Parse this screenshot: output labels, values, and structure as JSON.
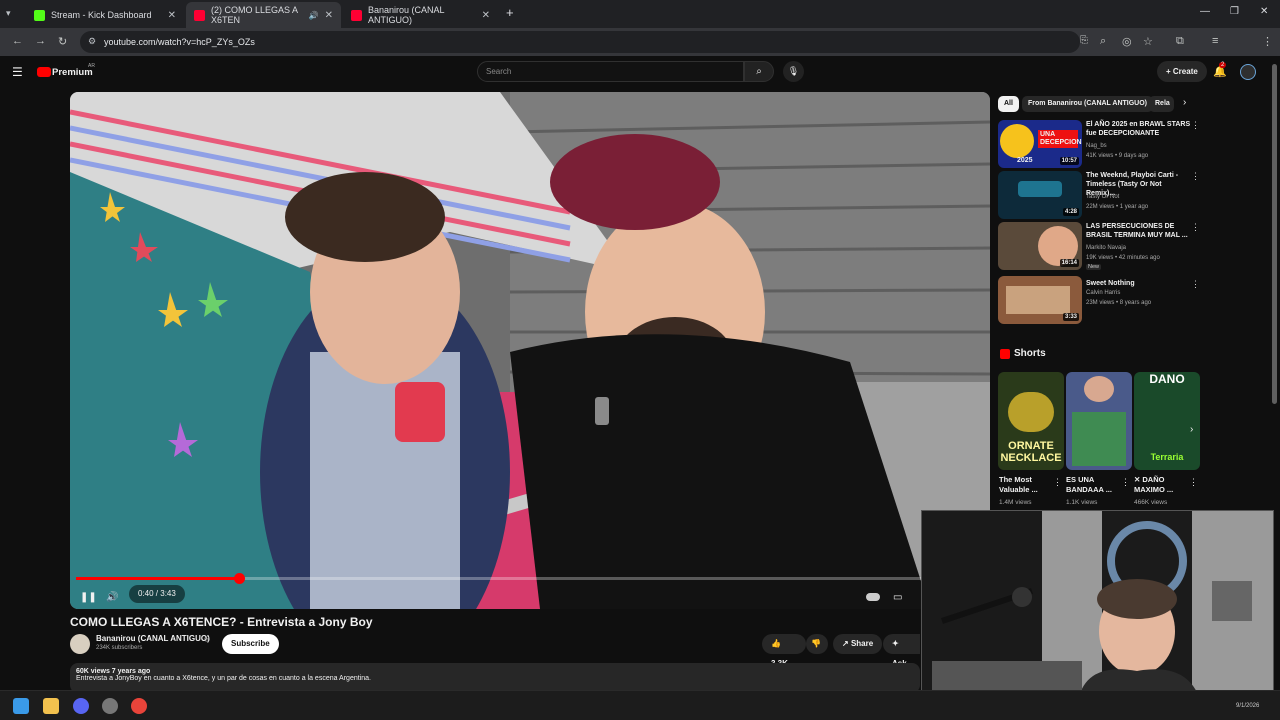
{
  "browser": {
    "tabs": [
      {
        "label": "Stream - Kick Dashboard",
        "color": "#53fc18"
      },
      {
        "label": "(2) COMO LLEGAS A X6TEN",
        "color": "#ff0033"
      },
      {
        "label": "Bananirou (CANAL ANTIGUO)",
        "color": "#ff0033"
      }
    ],
    "new_tab": "+",
    "url": "youtube.com/watch?v=hcP_ZYs_OZs"
  },
  "youtube": {
    "logo": "Premium",
    "country": "AR",
    "search_placeholder": "Search",
    "create_label": "Create",
    "notification_count": "2"
  },
  "video": {
    "time": "0:40 / 3:43",
    "progress_fraction": 0.179,
    "title": "COMO LLEGAS A X6TENCE? - Entrevista a Jony Boy",
    "channel": "Bananirou (CANAL ANTIGUO)",
    "subscribers": "234K subscribers",
    "subscribe_label": "Subscribe",
    "likes": "3.3K",
    "share_label": "Share",
    "ask_label": "Ask",
    "views_age": "60K views  7 years ago",
    "description": "Entrevista a JonyBoy en cuanto a X6tence, y un par de cosas en cuanto a la escena Argentina."
  },
  "sidebar": {
    "chips": [
      "All",
      "From Bananirou (CANAL ANTIGUO)",
      "Rela"
    ],
    "recommendations": [
      {
        "title": "El AÑO 2025 en BRAWL STARS fue DECEPCIONANTE",
        "channel": "Nag_bs",
        "meta": "41K views • 9 days ago",
        "duration": "10:57",
        "thumb_label": "UNA DECEPCION",
        "thumb_year": "2025",
        "color": "#1b2a8a"
      },
      {
        "title": "The Weeknd, Playboi Carti - Timeless (Tasty Or Not Remix)...",
        "channel": "Tasty Or Not",
        "meta": "22M views • 1 year ago",
        "duration": "4:28",
        "color": "#0d2a3a"
      },
      {
        "title": "LAS PERSECUCIONES DE BRASIL TERMINA MUY MAL ...",
        "channel": "Markito Navaja",
        "meta": "19K views • 42 minutes ago",
        "badge": "New",
        "duration": "16:14",
        "color": "#5a4a3a"
      },
      {
        "title": "Sweet Nothing",
        "channel": "Calvin Harris",
        "meta": "23M views • 8 years ago",
        "duration": "3:33",
        "color": "#8b5a3c"
      }
    ],
    "shorts_label": "Shorts",
    "shorts": [
      {
        "title": "The Most Valuable ...",
        "views": "1.4M views",
        "thumb_text": "ORNATE NECKLACE",
        "color": "#2a3a1a"
      },
      {
        "title": "ES UNA BANDAAA ...",
        "views": "1.1K views",
        "color": "#4a5a8a"
      },
      {
        "title": "✕ DAÑO MAXIMO ...",
        "views": "466K views",
        "thumb_text": "DANO",
        "thumb_sub": "Terraria",
        "color": "#1a4a2a"
      }
    ]
  },
  "taskbar": {
    "date": "9/1/2026"
  }
}
